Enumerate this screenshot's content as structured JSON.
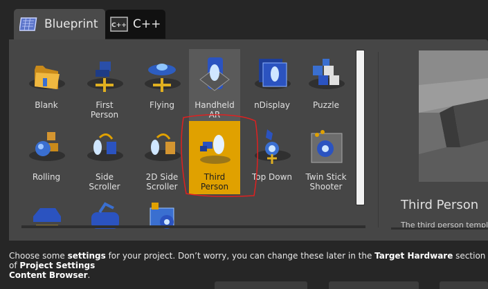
{
  "tabs": [
    {
      "label": "Blueprint",
      "icon": "blueprint-icon",
      "active": true
    },
    {
      "label": "C++",
      "icon": "cpp-icon",
      "active": false
    }
  ],
  "templates": [
    {
      "label": "Blank",
      "icon": "folder-icon",
      "selected": false
    },
    {
      "label": "First\nPerson",
      "icon": "first-person-icon",
      "selected": false
    },
    {
      "label": "Flying",
      "icon": "flying-icon",
      "selected": false
    },
    {
      "label": "Handheld\nAR",
      "icon": "handheld-ar-icon",
      "selected": false
    },
    {
      "label": "nDisplay",
      "icon": "ndisplay-icon",
      "selected": false
    },
    {
      "label": "Puzzle",
      "icon": "puzzle-icon",
      "selected": false
    },
    {
      "label": "Rolling",
      "icon": "rolling-icon",
      "selected": false
    },
    {
      "label": "Side\nScroller",
      "icon": "side-scroller-icon",
      "selected": false
    },
    {
      "label": "2D Side\nScroller",
      "icon": "2d-side-scroller-icon",
      "selected": false
    },
    {
      "label": "Third\nPerson",
      "icon": "third-person-icon",
      "selected": true
    },
    {
      "label": "Top Down",
      "icon": "top-down-icon",
      "selected": false
    },
    {
      "label": "Twin Stick\nShooter",
      "icon": "twin-stick-shooter-icon",
      "selected": false
    },
    {
      "label": "",
      "icon": "vehicle-icon",
      "selected": false
    },
    {
      "label": "",
      "icon": "vr-icon",
      "selected": false
    },
    {
      "label": "",
      "icon": "vehicle-advanced-icon",
      "selected": false
    }
  ],
  "preview": {
    "title": "Third Person",
    "description": "The third person templa"
  },
  "footer": {
    "text_1": "Choose some ",
    "bold_1": "settings",
    "text_2": " for your project.  Don’t worry, you can change these later in the ",
    "bold_2": "Target Hardware",
    "text_3": " section of ",
    "bold_3": "Project Settings",
    "bold_4": "Content Browser",
    "text_4": "."
  },
  "colors": {
    "selected": "#e0a100",
    "panel": "#464646",
    "annotation": "#e02020"
  }
}
